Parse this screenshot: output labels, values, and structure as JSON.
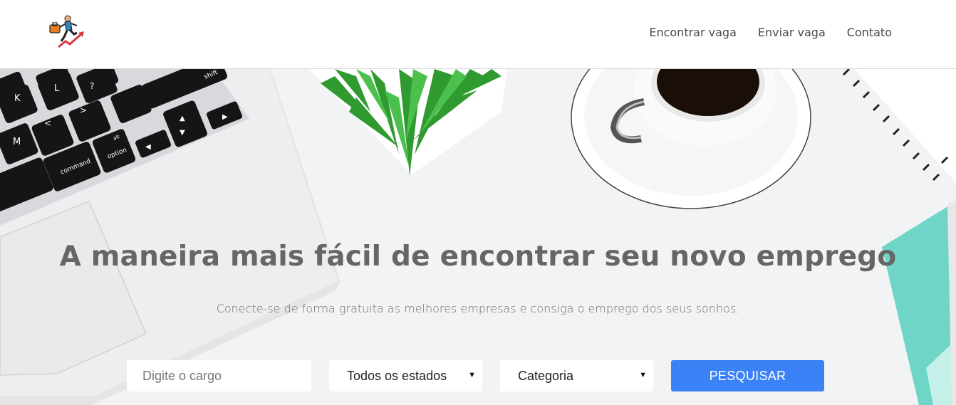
{
  "nav": {
    "links": [
      "Encontrar vaga",
      "Enviar vaga",
      "Contato"
    ]
  },
  "hero": {
    "title": "A maneira mais fácil de encontrar seu novo emprego",
    "subtitle": "Conecte-se de forma gratuita as melhores empresas e consiga o emprego dos seus sonhos."
  },
  "search": {
    "job_placeholder": "Digite o cargo",
    "state_selected": "Todos os estados",
    "category_selected": "Categoria",
    "button_label": "PESQUISAR"
  },
  "keyboard": {
    "keys": [
      "shift",
      "K",
      "L",
      "M",
      "command",
      "option",
      "alt"
    ]
  },
  "colors": {
    "accent": "#3b82f6",
    "teal": "#6fd6c7"
  }
}
